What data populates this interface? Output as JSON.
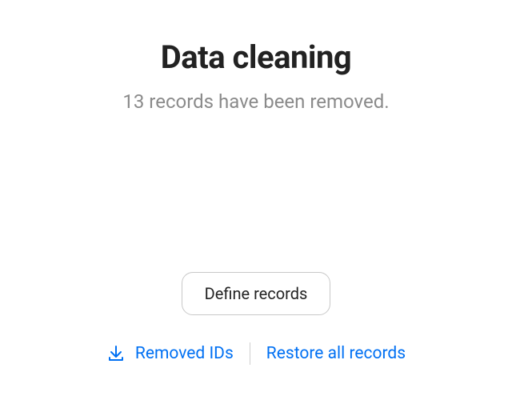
{
  "header": {
    "title": "Data cleaning",
    "subtitle": "13 records have been removed."
  },
  "actions": {
    "define_label": "Define records",
    "removed_ids_label": "Removed IDs",
    "restore_label": "Restore all records"
  },
  "colors": {
    "link": "#0070f3",
    "text_muted": "#8a8a8a",
    "text_primary": "#222"
  }
}
